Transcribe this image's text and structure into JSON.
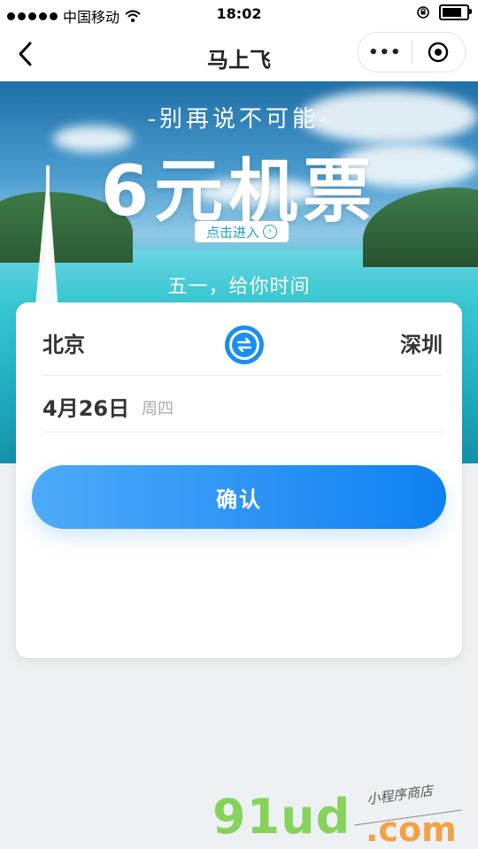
{
  "status_bar": {
    "carrier": "中国移动",
    "time": "18:02"
  },
  "nav": {
    "title": "马上飞",
    "more_glyph": "•••",
    "close_glyph": "◉"
  },
  "banner": {
    "subtitle": "-别再说不可能-",
    "headline": "6元机票",
    "enter_label": "点击进入",
    "enter_arrow": "›",
    "slogan": "五一，给你时间"
  },
  "booking": {
    "from_city": "北京",
    "to_city": "深圳",
    "date": "4月26日",
    "weekday": "周四",
    "confirm_label": "确认"
  },
  "watermark": {
    "brand": "91ud",
    "domain": ".com",
    "tagline": "小程序商店"
  },
  "colors": {
    "accent": "#1a8ef0",
    "button_start": "#4eaaf9",
    "button_end": "#0f80f2"
  }
}
